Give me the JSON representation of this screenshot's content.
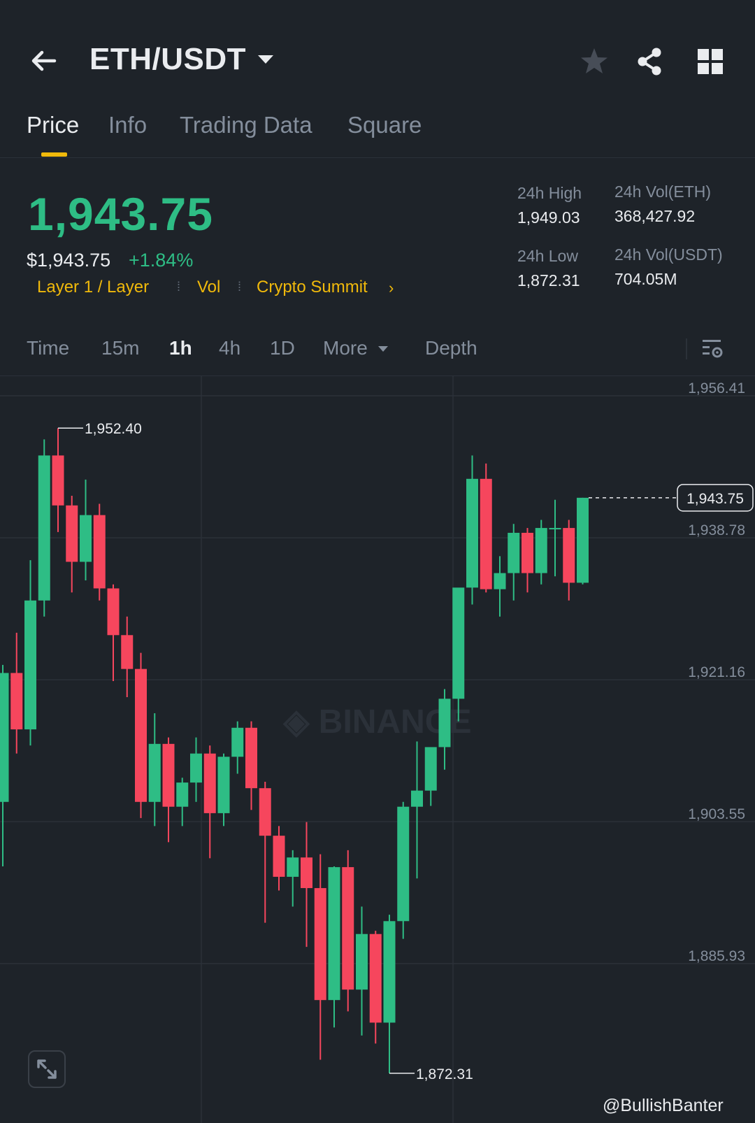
{
  "header": {
    "pair": "ETH/USDT",
    "icons": {
      "back": "arrow-left-icon",
      "caret": "caret-down-icon",
      "favorite": "star-icon",
      "share": "share-icon",
      "more": "grid-icon"
    }
  },
  "tabs": [
    {
      "label": "Price",
      "active": true
    },
    {
      "label": "Info",
      "active": false
    },
    {
      "label": "Trading Data",
      "active": false
    },
    {
      "label": "Square",
      "active": false
    }
  ],
  "ticker": {
    "last_price": "1,943.75",
    "usd_price": "$1,943.75",
    "change_pct": "+1.84%",
    "tags": [
      "Layer 1 / Layer",
      "Vol",
      "Crypto Summit"
    ],
    "high_label": "24h High",
    "high_value": "1,949.03",
    "vol_eth_label": "24h Vol(ETH)",
    "vol_eth_value": "368,427.92",
    "low_label": "24h Low",
    "low_value": "1,872.31",
    "vol_usdt_label": "24h Vol(USDT)",
    "vol_usdt_value": "704.05M"
  },
  "intervals": [
    {
      "label": "Time",
      "active": false
    },
    {
      "label": "15m",
      "active": false
    },
    {
      "label": "1h",
      "active": true
    },
    {
      "label": "4h",
      "active": false
    },
    {
      "label": "1D",
      "active": false
    },
    {
      "label": "More",
      "active": false
    },
    {
      "label": "Depth",
      "active": false
    }
  ],
  "colors": {
    "up": "#2ebd85",
    "down": "#f6465d",
    "accent": "#f0b90b",
    "background": "#1e2329",
    "muted": "#848e9c"
  },
  "chart_data": {
    "type": "candlestick",
    "interval": "1h",
    "y_ticks": [
      "1,956.41",
      "1,938.78",
      "1,921.16",
      "1,903.55",
      "1,885.93"
    ],
    "ylim": [
      1870,
      1960
    ],
    "current_price_label": "1,943.75",
    "high_marker": "1,952.40",
    "low_marker": "1,872.31",
    "watermark": "BINANCE",
    "candles": [
      {
        "o": 1906.0,
        "h": 1923.0,
        "l": 1898.0,
        "c": 1922.0
      },
      {
        "o": 1922.0,
        "h": 1927.0,
        "l": 1912.0,
        "c": 1915.0
      },
      {
        "o": 1915.0,
        "h": 1936.0,
        "l": 1913.0,
        "c": 1931.0
      },
      {
        "o": 1931.0,
        "h": 1951.0,
        "l": 1929.0,
        "c": 1949.0
      },
      {
        "o": 1949.0,
        "h": 1952.4,
        "l": 1939.5,
        "c": 1942.8
      },
      {
        "o": 1942.8,
        "h": 1944.0,
        "l": 1932.0,
        "c": 1935.8
      },
      {
        "o": 1935.8,
        "h": 1946.0,
        "l": 1933.5,
        "c": 1941.6
      },
      {
        "o": 1941.6,
        "h": 1943.0,
        "l": 1931.0,
        "c": 1932.5
      },
      {
        "o": 1932.5,
        "h": 1933.0,
        "l": 1921.0,
        "c": 1926.7
      },
      {
        "o": 1926.7,
        "h": 1929.0,
        "l": 1919.0,
        "c": 1922.5
      },
      {
        "o": 1922.5,
        "h": 1924.5,
        "l": 1904.0,
        "c": 1906.0
      },
      {
        "o": 1906.0,
        "h": 1917.0,
        "l": 1903.0,
        "c": 1913.2
      },
      {
        "o": 1913.2,
        "h": 1914.0,
        "l": 1901.0,
        "c": 1905.4
      },
      {
        "o": 1905.4,
        "h": 1909.0,
        "l": 1903.0,
        "c": 1908.4
      },
      {
        "o": 1908.4,
        "h": 1914.0,
        "l": 1906.0,
        "c": 1912.0
      },
      {
        "o": 1912.0,
        "h": 1913.0,
        "l": 1899.0,
        "c": 1904.6
      },
      {
        "o": 1904.6,
        "h": 1912.0,
        "l": 1903.0,
        "c": 1911.6
      },
      {
        "o": 1911.6,
        "h": 1916.0,
        "l": 1909.5,
        "c": 1915.2
      },
      {
        "o": 1915.2,
        "h": 1916.0,
        "l": 1905.0,
        "c": 1907.7
      },
      {
        "o": 1907.7,
        "h": 1908.5,
        "l": 1891.0,
        "c": 1901.8
      },
      {
        "o": 1901.8,
        "h": 1903.0,
        "l": 1895.0,
        "c": 1896.7
      },
      {
        "o": 1896.7,
        "h": 1900.0,
        "l": 1893.0,
        "c": 1899.1
      },
      {
        "o": 1899.1,
        "h": 1903.5,
        "l": 1888.0,
        "c": 1895.3
      },
      {
        "o": 1895.3,
        "h": 1899.5,
        "l": 1874.0,
        "c": 1881.4
      },
      {
        "o": 1881.4,
        "h": 1898.0,
        "l": 1878.0,
        "c": 1897.9
      },
      {
        "o": 1897.9,
        "h": 1900.0,
        "l": 1880.0,
        "c": 1882.7
      },
      {
        "o": 1882.7,
        "h": 1893.0,
        "l": 1877.0,
        "c": 1889.6
      },
      {
        "o": 1889.6,
        "h": 1890.0,
        "l": 1876.0,
        "c": 1878.6
      },
      {
        "o": 1878.6,
        "h": 1892.0,
        "l": 1872.31,
        "c": 1891.2
      },
      {
        "o": 1891.2,
        "h": 1906.0,
        "l": 1889.0,
        "c": 1905.4
      },
      {
        "o": 1905.4,
        "h": 1913.5,
        "l": 1896.5,
        "c": 1907.4
      },
      {
        "o": 1907.4,
        "h": 1910.0,
        "l": 1905.5,
        "c": 1912.8
      },
      {
        "o": 1912.8,
        "h": 1920.0,
        "l": 1910.0,
        "c": 1918.8
      },
      {
        "o": 1918.8,
        "h": 1931.0,
        "l": 1916.0,
        "c": 1932.6
      },
      {
        "o": 1932.6,
        "h": 1949.0,
        "l": 1930.5,
        "c": 1946.1
      },
      {
        "o": 1946.1,
        "h": 1948.0,
        "l": 1932.0,
        "c": 1932.4
      },
      {
        "o": 1932.4,
        "h": 1936.5,
        "l": 1929.0,
        "c": 1934.4
      },
      {
        "o": 1934.4,
        "h": 1940.5,
        "l": 1931.0,
        "c": 1939.4
      },
      {
        "o": 1939.4,
        "h": 1940.0,
        "l": 1932.0,
        "c": 1934.4
      },
      {
        "o": 1934.4,
        "h": 1941.0,
        "l": 1933.0,
        "c": 1940.0
      },
      {
        "o": 1940.0,
        "h": 1943.5,
        "l": 1934.0,
        "c": 1940.0
      },
      {
        "o": 1940.0,
        "h": 1941.0,
        "l": 1931.0,
        "c": 1933.2
      },
      {
        "o": 1933.2,
        "h": 1943.75,
        "l": 1933.0,
        "c": 1943.75
      }
    ]
  },
  "expand_icon": "expand-icon",
  "credit": "@BullishBanter"
}
